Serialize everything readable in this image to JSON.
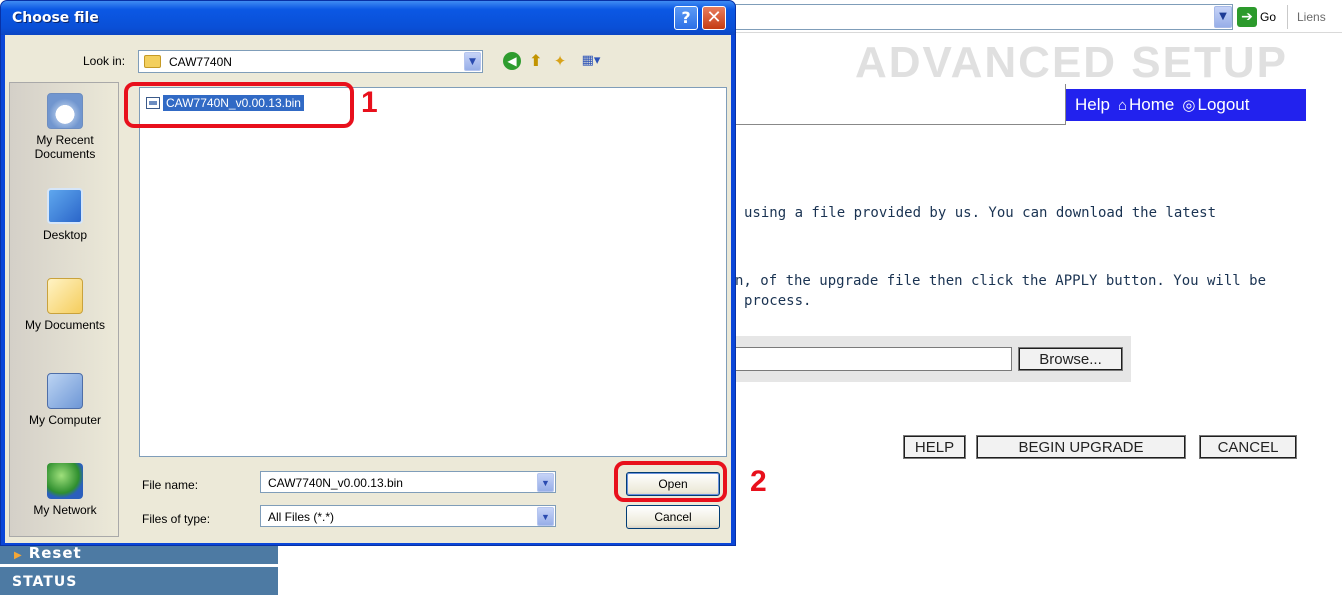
{
  "dialog": {
    "title": "Choose file",
    "help_btn": "?",
    "close_btn": "✕",
    "lookin_label": "Look in:",
    "lookin_value": "CAW7740N",
    "places": [
      {
        "label": "My Recent\nDocuments",
        "icon": "recent-documents-icon"
      },
      {
        "label": "Desktop",
        "icon": "desktop-icon"
      },
      {
        "label": "My Documents",
        "icon": "my-documents-icon"
      },
      {
        "label": "My Computer",
        "icon": "my-computer-icon"
      },
      {
        "label": "My Network",
        "icon": "my-network-icon"
      }
    ],
    "files": [
      {
        "name": "CAW7740N_v0.00.13.bin",
        "selected": true
      }
    ],
    "filename_label": "File name:",
    "filename_value": "CAW7740N_v0.00.13.bin",
    "filetype_label": "Files of type:",
    "filetype_value": "All Files (*.*)",
    "open_btn": "Open",
    "cancel_btn": "Cancel"
  },
  "annotations": {
    "callout1": "1",
    "callout2": "2",
    "color": "#e8101c"
  },
  "browser": {
    "go_label": "Go",
    "links_label": "Liens"
  },
  "page": {
    "title": "ADVANCED SETUP",
    "nav": {
      "help": "Help",
      "home": "Home",
      "logout": "Logout"
    },
    "para1": "using a file provided by us. You can download the latest",
    "para2_line1": "n, of the upgrade file then click the APPLY button. You will be",
    "para2_line2": "process.",
    "browse_btn": "Browse...",
    "help_btn": "HELP",
    "begin_btn": "BEGIN UPGRADE",
    "cancel_btn": "CANCEL",
    "sidebar": {
      "reset": "Reset",
      "status": "STATUS"
    },
    "colors": {
      "nav_bg": "#2222ee",
      "sidebar_bg": "#4d7aa3",
      "title_color": "#e0e0e0"
    }
  }
}
